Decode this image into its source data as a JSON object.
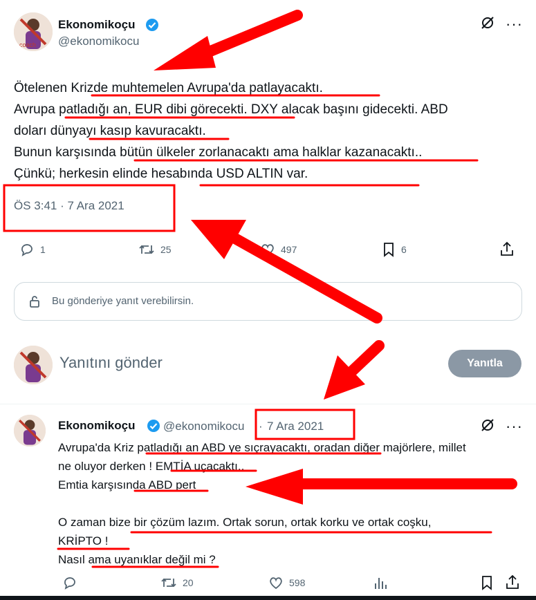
{
  "tweet": {
    "author_name": "Ekonomikoçu",
    "author_handle": "@ekonomikocu",
    "text": "Ötelenen Krizde muhtemelen Avrupa'da patlayacaktı.\nAvrupa patladığı an, EUR dibi görecekti. DXY alacak başını gidecekti. ABD\ndoları dünyayı kasıp kavuracaktı.\nBunun karşısında bütün ülkeler zorlanacaktı ama halklar kazanacaktı..\nÇünkü; herkesin elinde hesabında USD ALTIN var.",
    "timestamp": "ÖS 3:41 · 7 Ara 2021",
    "replies": "1",
    "retweets": "25",
    "likes": "497",
    "bookmarks": "6"
  },
  "reply_notice": "Bu gönderiye yanıt verebilirsin.",
  "composer": {
    "placeholder": "Yanıtını gönder",
    "button_label": "Yanıtla"
  },
  "reply_tweet": {
    "author_name": "Ekonomikoçu",
    "author_handle": "@ekonomikocu",
    "separator": "·",
    "date": "7 Ara 2021",
    "text": "Avrupa'da Kriz patladığı an ABD ye sıçrayacaktı, oradan diğer majörlere, millet\nne oluyor derken ! EMTİA uçacaktı..\nEmtia karşısında ABD pert\n\nO zaman bize bir çözüm lazım.  Ortak sorun, ortak korku ve ortak coşku,\nKRİPTO !\nNasıl ama uyanıklar değil mi ?",
    "retweets": "20",
    "likes": "598"
  },
  "colors": {
    "accent": "#1d9bf0",
    "annotation": "#ff0000",
    "muted": "#536471",
    "button_disabled": "#8b98a5"
  }
}
